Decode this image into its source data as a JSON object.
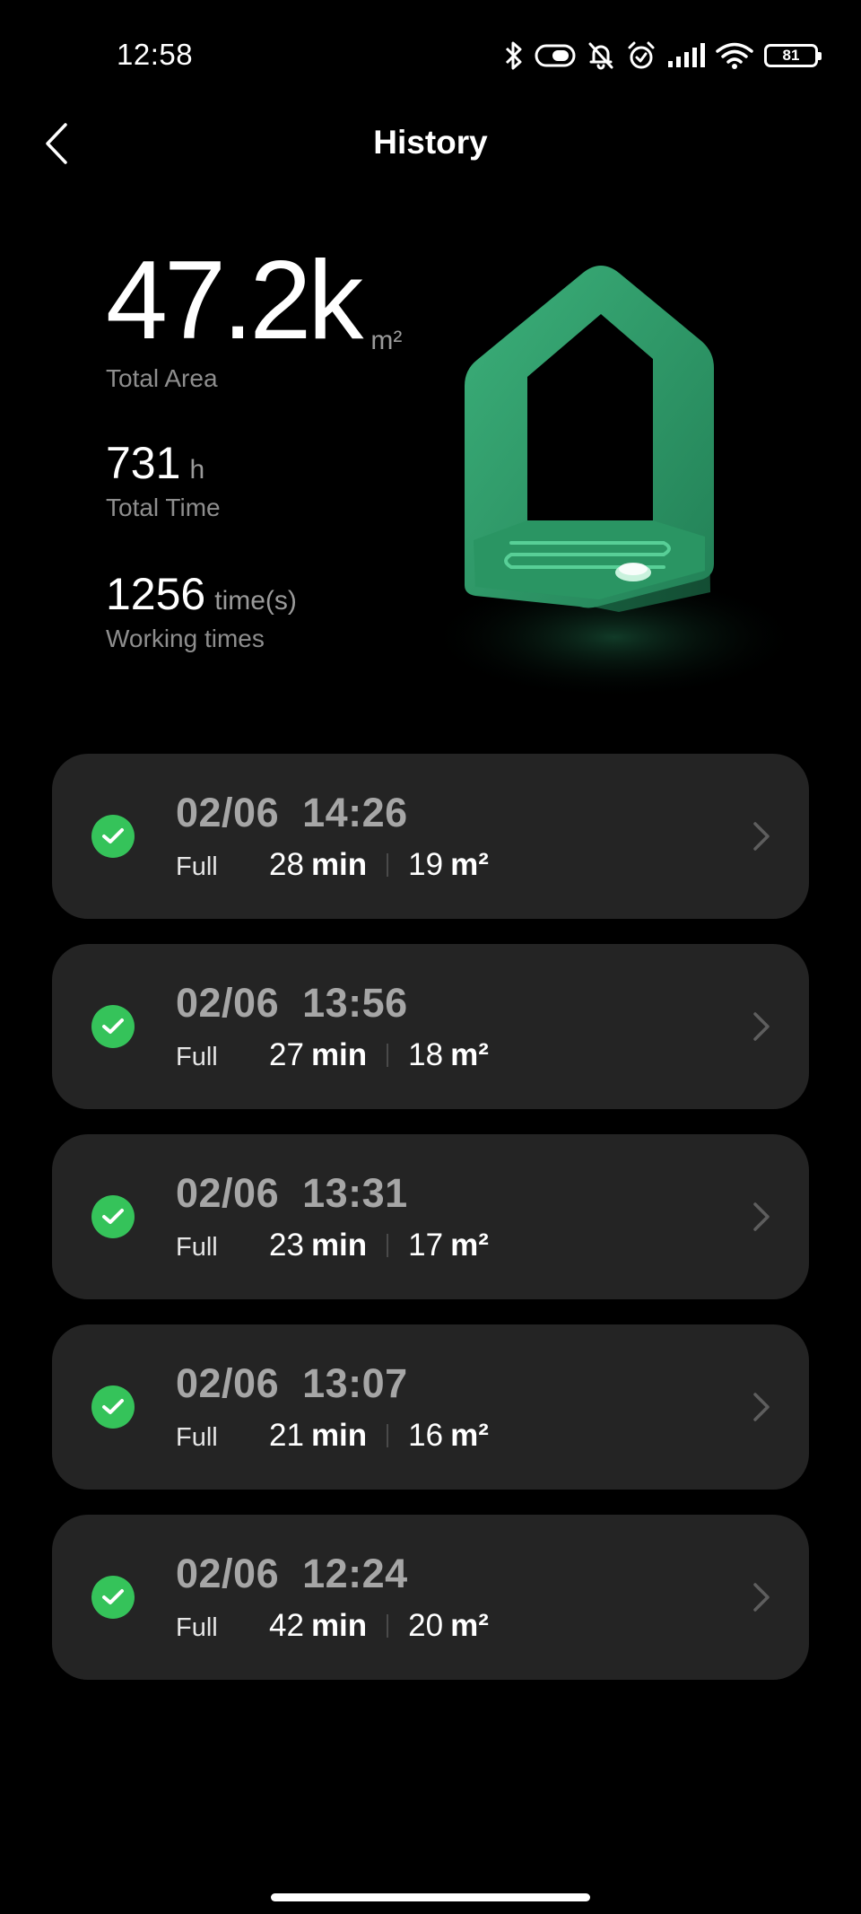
{
  "status_bar": {
    "time": "12:58",
    "battery": "81",
    "icons": [
      "bluetooth-icon",
      "toggle-icon",
      "bell-off-icon",
      "alarm-icon",
      "signal-icon",
      "wifi-icon",
      "battery-icon"
    ]
  },
  "header": {
    "title": "History",
    "back_icon": "chevron-left-icon"
  },
  "summary": {
    "area_value": "47.2k",
    "area_unit": "m²",
    "area_label": "Total Area",
    "time_value": "731",
    "time_unit": "h",
    "time_label": "Total Time",
    "count_value": "1256",
    "count_unit": "time(s)",
    "count_label": "Working times"
  },
  "history": {
    "records": [
      {
        "date": "02/06  14:26",
        "mode": "Full",
        "duration": "28",
        "duration_unit": "min",
        "area": "19",
        "area_unit": "m²",
        "status": "completed"
      },
      {
        "date": "02/06  13:56",
        "mode": "Full",
        "duration": "27",
        "duration_unit": "min",
        "area": "18",
        "area_unit": "m²",
        "status": "completed"
      },
      {
        "date": "02/06  13:31",
        "mode": "Full",
        "duration": "23",
        "duration_unit": "min",
        "area": "17",
        "area_unit": "m²",
        "status": "completed"
      },
      {
        "date": "02/06  13:07",
        "mode": "Full",
        "duration": "21",
        "duration_unit": "min",
        "area": "16",
        "area_unit": "m²",
        "status": "completed"
      },
      {
        "date": "02/06  12:24",
        "mode": "Full",
        "duration": "42",
        "duration_unit": "min",
        "area": "20",
        "area_unit": "m²",
        "status": "completed"
      }
    ]
  },
  "colors": {
    "background": "#000000",
    "card": "#242424",
    "success": "#35c35a",
    "house": "#2e9e6a"
  }
}
